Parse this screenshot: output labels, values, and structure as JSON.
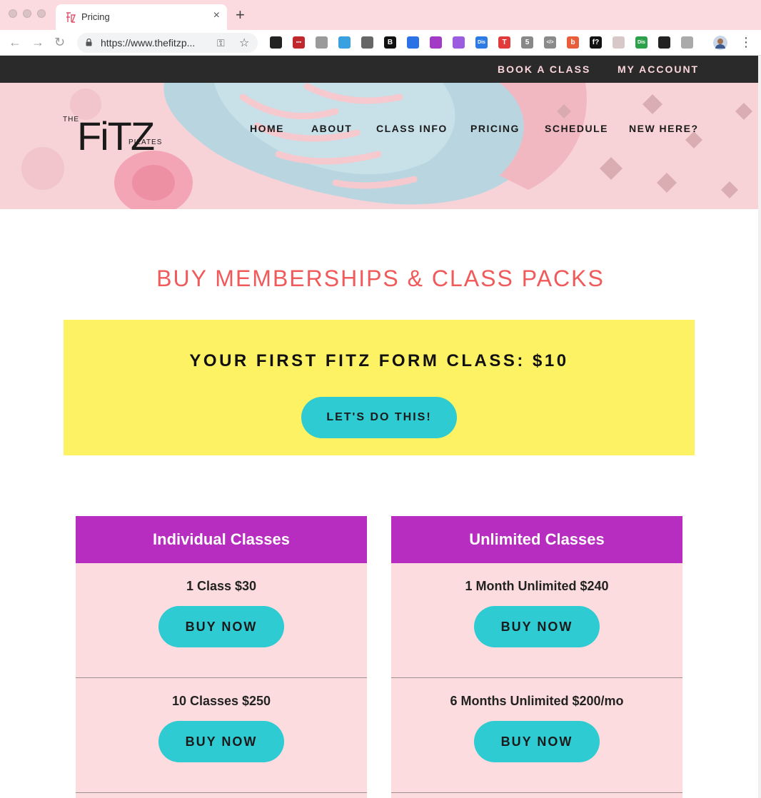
{
  "browser": {
    "tab_title": "Pricing",
    "tab_close": "×",
    "new_tab": "+",
    "url": "https://www.thefitzp...",
    "extensions": [
      {
        "icon": "chrome-ext-color-wheel-icon",
        "color": "#222222",
        "text": ""
      },
      {
        "icon": "chrome-ext-red-grid-icon",
        "color": "#c0282d",
        "text": "▪▪▪"
      },
      {
        "icon": "chrome-ext-camera-icon",
        "color": "#9a9a9a",
        "text": ""
      },
      {
        "icon": "chrome-ext-rainbow-icon",
        "color": "#3aa1e0",
        "text": ""
      },
      {
        "icon": "chrome-ext-spiral-icon",
        "color": "#666666",
        "text": ""
      },
      {
        "icon": "chrome-ext-b-icon",
        "color": "#111111",
        "text": "B"
      },
      {
        "icon": "chrome-ext-dropbox-icon",
        "color": "#2a72e5",
        "text": ""
      },
      {
        "icon": "chrome-ext-eyedropper-icon",
        "color": "#a33ac6",
        "text": ""
      },
      {
        "icon": "chrome-ext-purple-gem-icon",
        "color": "#9b5ce0",
        "text": ""
      },
      {
        "icon": "chrome-ext-dis-icon",
        "color": "#2c7be5",
        "text": "Dis"
      },
      {
        "icon": "chrome-ext-red-t-icon",
        "color": "#e23b3b",
        "text": "T"
      },
      {
        "icon": "chrome-ext-fingerprint-icon",
        "color": "#888888",
        "text": "5"
      },
      {
        "icon": "chrome-ext-code-icon",
        "color": "#8a8a8a",
        "text": "</>"
      },
      {
        "icon": "chrome-ext-b-circle-icon",
        "color": "#e85d3a",
        "text": "b"
      },
      {
        "icon": "chrome-ext-font-icon",
        "color": "#111111",
        "text": "f?"
      },
      {
        "icon": "chrome-ext-page-icon",
        "color": "#d8c8c8",
        "text": ""
      },
      {
        "icon": "chrome-ext-dis-green-icon",
        "color": "#2ca04a",
        "text": "Dis"
      },
      {
        "icon": "chrome-ext-cloud-icon",
        "color": "#222222",
        "text": ""
      },
      {
        "icon": "chrome-ext-refresh-icon",
        "color": "#aaaaaa",
        "text": ""
      }
    ]
  },
  "topbar": {
    "book_a_class": "BOOK A CLASS",
    "my_account": "MY ACCOUNT"
  },
  "logo": {
    "the": "THE",
    "fitz": "FiTZ",
    "pilates": "PILATES"
  },
  "nav": {
    "home": "HOME",
    "about": "ABOUT",
    "class_info": "CLASS INFO",
    "pricing": "PRICING",
    "schedule": "SCHEDULE",
    "new_here": "NEW HERE?"
  },
  "main": {
    "heading": "BUY MEMBERSHIPS & CLASS PACKS",
    "promo_title": "YOUR FIRST FITZ FORM CLASS: $10",
    "promo_button": "LET'S DO THIS!"
  },
  "cards": [
    {
      "title": "Individual Classes",
      "rows": [
        {
          "label": "1 Class $30",
          "button": "BUY NOW"
        },
        {
          "label": "10 Classes $250",
          "button": "BUY NOW"
        }
      ]
    },
    {
      "title": "Unlimited Classes",
      "rows": [
        {
          "label": "1 Month Unlimited $240",
          "button": "BUY NOW"
        },
        {
          "label": "6 Months Unlimited $200/mo",
          "button": "BUY NOW"
        }
      ]
    }
  ],
  "colors": {
    "brand_coral": "#f05a5a",
    "promo_yellow": "#fdf164",
    "button_teal": "#2ecbd3",
    "card_header_purple": "#b72dbf",
    "card_bg_pink": "#fcdcdf",
    "topbar_dark": "#2a2a2a"
  }
}
